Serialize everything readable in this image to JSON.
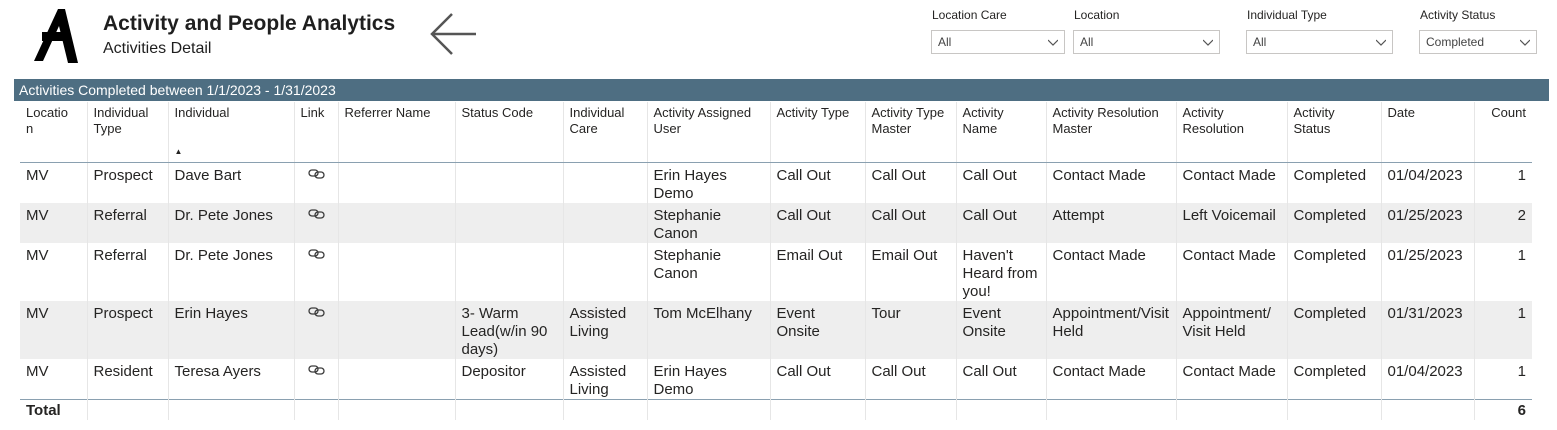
{
  "header": {
    "title": "Activity and People Analytics",
    "subtitle": "Activities Detail"
  },
  "filters": [
    {
      "label": "Location Care",
      "value": "All"
    },
    {
      "label": "Location",
      "value": "All"
    },
    {
      "label": "Individual Type",
      "value": "All"
    },
    {
      "label": "Activity Status",
      "value": "Completed"
    }
  ],
  "banner": "Activities Completed between 1/1/2023 - 1/31/2023",
  "table": {
    "columns": [
      "Locatio\nn",
      "Individual Type",
      "Individual",
      "Link",
      "Referrer Name",
      "Status Code",
      "Individual Care",
      "Activity Assigned User",
      "Activity Type",
      "Activity Type Master",
      "Activity Name",
      "Activity Resolution Master",
      "Activity Resolution",
      "Activity Status",
      "Date",
      "Count"
    ],
    "rows": [
      [
        "MV",
        "Prospect",
        "Dave Bart",
        "",
        "",
        "",
        "",
        "Erin Hayes Demo",
        "Call Out",
        "Call Out",
        "Call Out",
        "Contact Made",
        "Contact Made",
        "Completed",
        "01/04/2023",
        "1"
      ],
      [
        "MV",
        "Referral",
        "Dr. Pete Jones",
        "",
        "",
        "",
        "",
        "Stephanie Canon",
        "Call Out",
        "Call Out",
        "Call Out",
        "Attempt",
        "Left Voicemail",
        "Completed",
        "01/25/2023",
        "2"
      ],
      [
        "MV",
        "Referral",
        "Dr. Pete Jones",
        "",
        "",
        "",
        "",
        "Stephanie Canon",
        "Email Out",
        "Email Out",
        "Haven't Heard from you!",
        "Contact Made",
        "Contact Made",
        "Completed",
        "01/25/2023",
        "1"
      ],
      [
        "MV",
        "Prospect",
        "Erin Hayes",
        "",
        "",
        "3- Warm Lead(w/in 90 days)",
        "Assisted Living",
        "Tom McElhany",
        "Event Onsite",
        "Tour",
        "Event Onsite",
        "Appointment/Visit Held",
        "Appointment/ Visit Held",
        "Completed",
        "01/31/2023",
        "1"
      ],
      [
        "MV",
        "Resident",
        "Teresa Ayers",
        "",
        "",
        "Depositor",
        "Assisted Living",
        "Erin Hayes Demo",
        "Call Out",
        "Call Out",
        "Call Out",
        "Contact Made",
        "Contact Made",
        "Completed",
        "01/04/2023",
        "1"
      ]
    ],
    "total_label": "Total",
    "total_count": "6"
  },
  "icons": {
    "logo": "brand-logo",
    "back": "arrow-left-icon",
    "link": "link-icon",
    "dropdown": "chevron-down-icon"
  }
}
